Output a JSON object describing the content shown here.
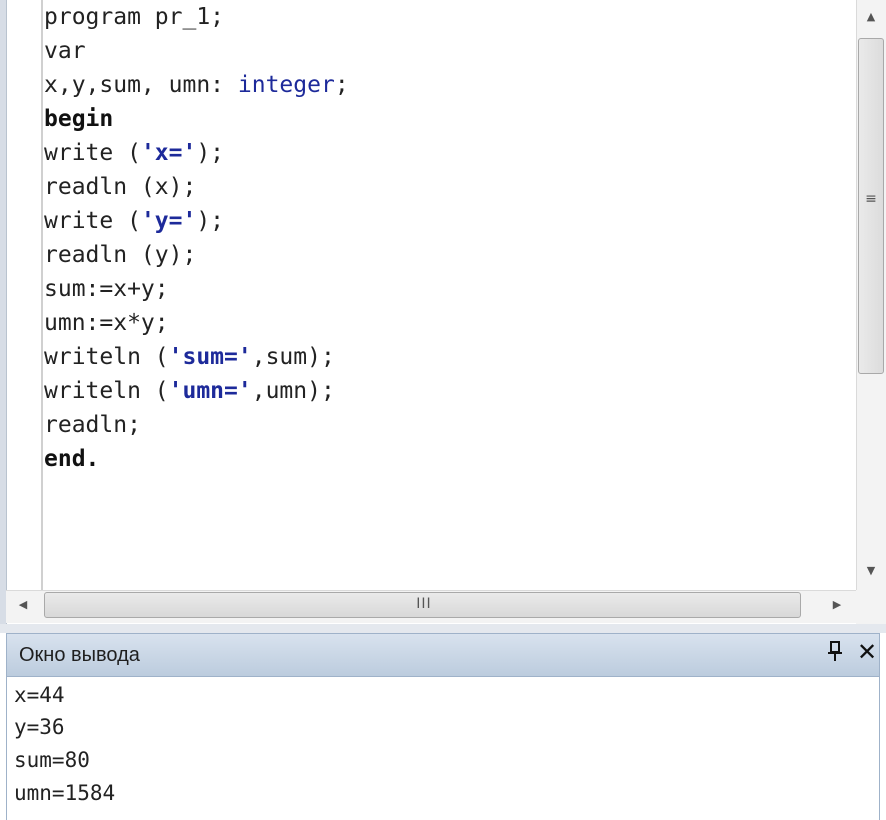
{
  "editor": {
    "code_lines": [
      [
        {
          "t": "program pr_1;",
          "c": ""
        }
      ],
      [
        {
          "t": "var",
          "c": ""
        }
      ],
      [
        {
          "t": "x,y,sum, umn: ",
          "c": ""
        },
        {
          "t": "integer",
          "c": "tp"
        },
        {
          "t": ";",
          "c": ""
        }
      ],
      [
        {
          "t": "begin",
          "c": "kw"
        }
      ],
      [
        {
          "t": "write (",
          "c": ""
        },
        {
          "t": "'x='",
          "c": "str"
        },
        {
          "t": ");",
          "c": ""
        }
      ],
      [
        {
          "t": "readln (x);",
          "c": ""
        }
      ],
      [
        {
          "t": "write (",
          "c": ""
        },
        {
          "t": "'y='",
          "c": "str"
        },
        {
          "t": ");",
          "c": ""
        }
      ],
      [
        {
          "t": "readln (y);",
          "c": ""
        }
      ],
      [
        {
          "t": "sum:=x+y;",
          "c": ""
        }
      ],
      [
        {
          "t": "umn:=x*y;",
          "c": ""
        }
      ],
      [
        {
          "t": "writeln (",
          "c": ""
        },
        {
          "t": "'sum='",
          "c": "str"
        },
        {
          "t": ",sum);",
          "c": ""
        }
      ],
      [
        {
          "t": "writeln (",
          "c": ""
        },
        {
          "t": "'umn='",
          "c": "str"
        },
        {
          "t": ",umn);",
          "c": ""
        }
      ],
      [
        {
          "t": "readln;",
          "c": ""
        }
      ],
      [
        {
          "t": "end.",
          "c": "kw"
        }
      ]
    ],
    "scroll_up_icon": "▲",
    "scroll_down_icon": "▼",
    "scroll_left_icon": "◀",
    "scroll_right_icon": "▶",
    "vscroll_grip": "☰",
    "hscroll_grip": "III"
  },
  "output": {
    "title": "Окно вывода",
    "pin_icon": "ꟷ",
    "close_icon": "✕",
    "lines": [
      "x=44",
      "y=36",
      "sum=80",
      "umn=1584"
    ]
  },
  "colors": {
    "keyword": "#111111",
    "type": "#1d2a9a",
    "string": "#1d2a9a",
    "panel_header": "#bcccde"
  }
}
